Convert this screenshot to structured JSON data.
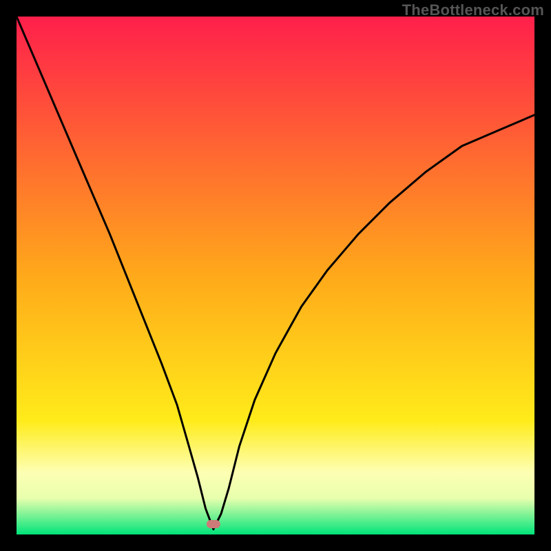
{
  "watermark": "TheBottleneck.com",
  "chart_data": {
    "type": "line",
    "title": "",
    "xlabel": "",
    "ylabel": "",
    "xlim": [
      0,
      100
    ],
    "ylim": [
      0,
      100
    ],
    "grid": false,
    "background_gradient": {
      "top": "#ff1f4b",
      "middle": "#ffeb1a",
      "bottom_band1": "#fdffb3",
      "bottom_band2": "#e8ffad",
      "bottom": "#00e47a"
    },
    "marker": {
      "x": 38,
      "y": 2,
      "color": "#cd7b78"
    },
    "series": [
      {
        "name": "curve",
        "color": "#000000",
        "x": [
          0,
          6,
          12,
          18,
          24,
          28,
          31,
          33,
          35,
          36.5,
          38,
          39.5,
          41,
          43,
          46,
          50,
          55,
          60,
          66,
          72,
          79,
          86,
          93,
          100
        ],
        "values": [
          100,
          86,
          72,
          58,
          43,
          33,
          25,
          18,
          11,
          5,
          1,
          4,
          9,
          17,
          26,
          35,
          44,
          51,
          58,
          64,
          70,
          75,
          78,
          81
        ]
      }
    ]
  }
}
